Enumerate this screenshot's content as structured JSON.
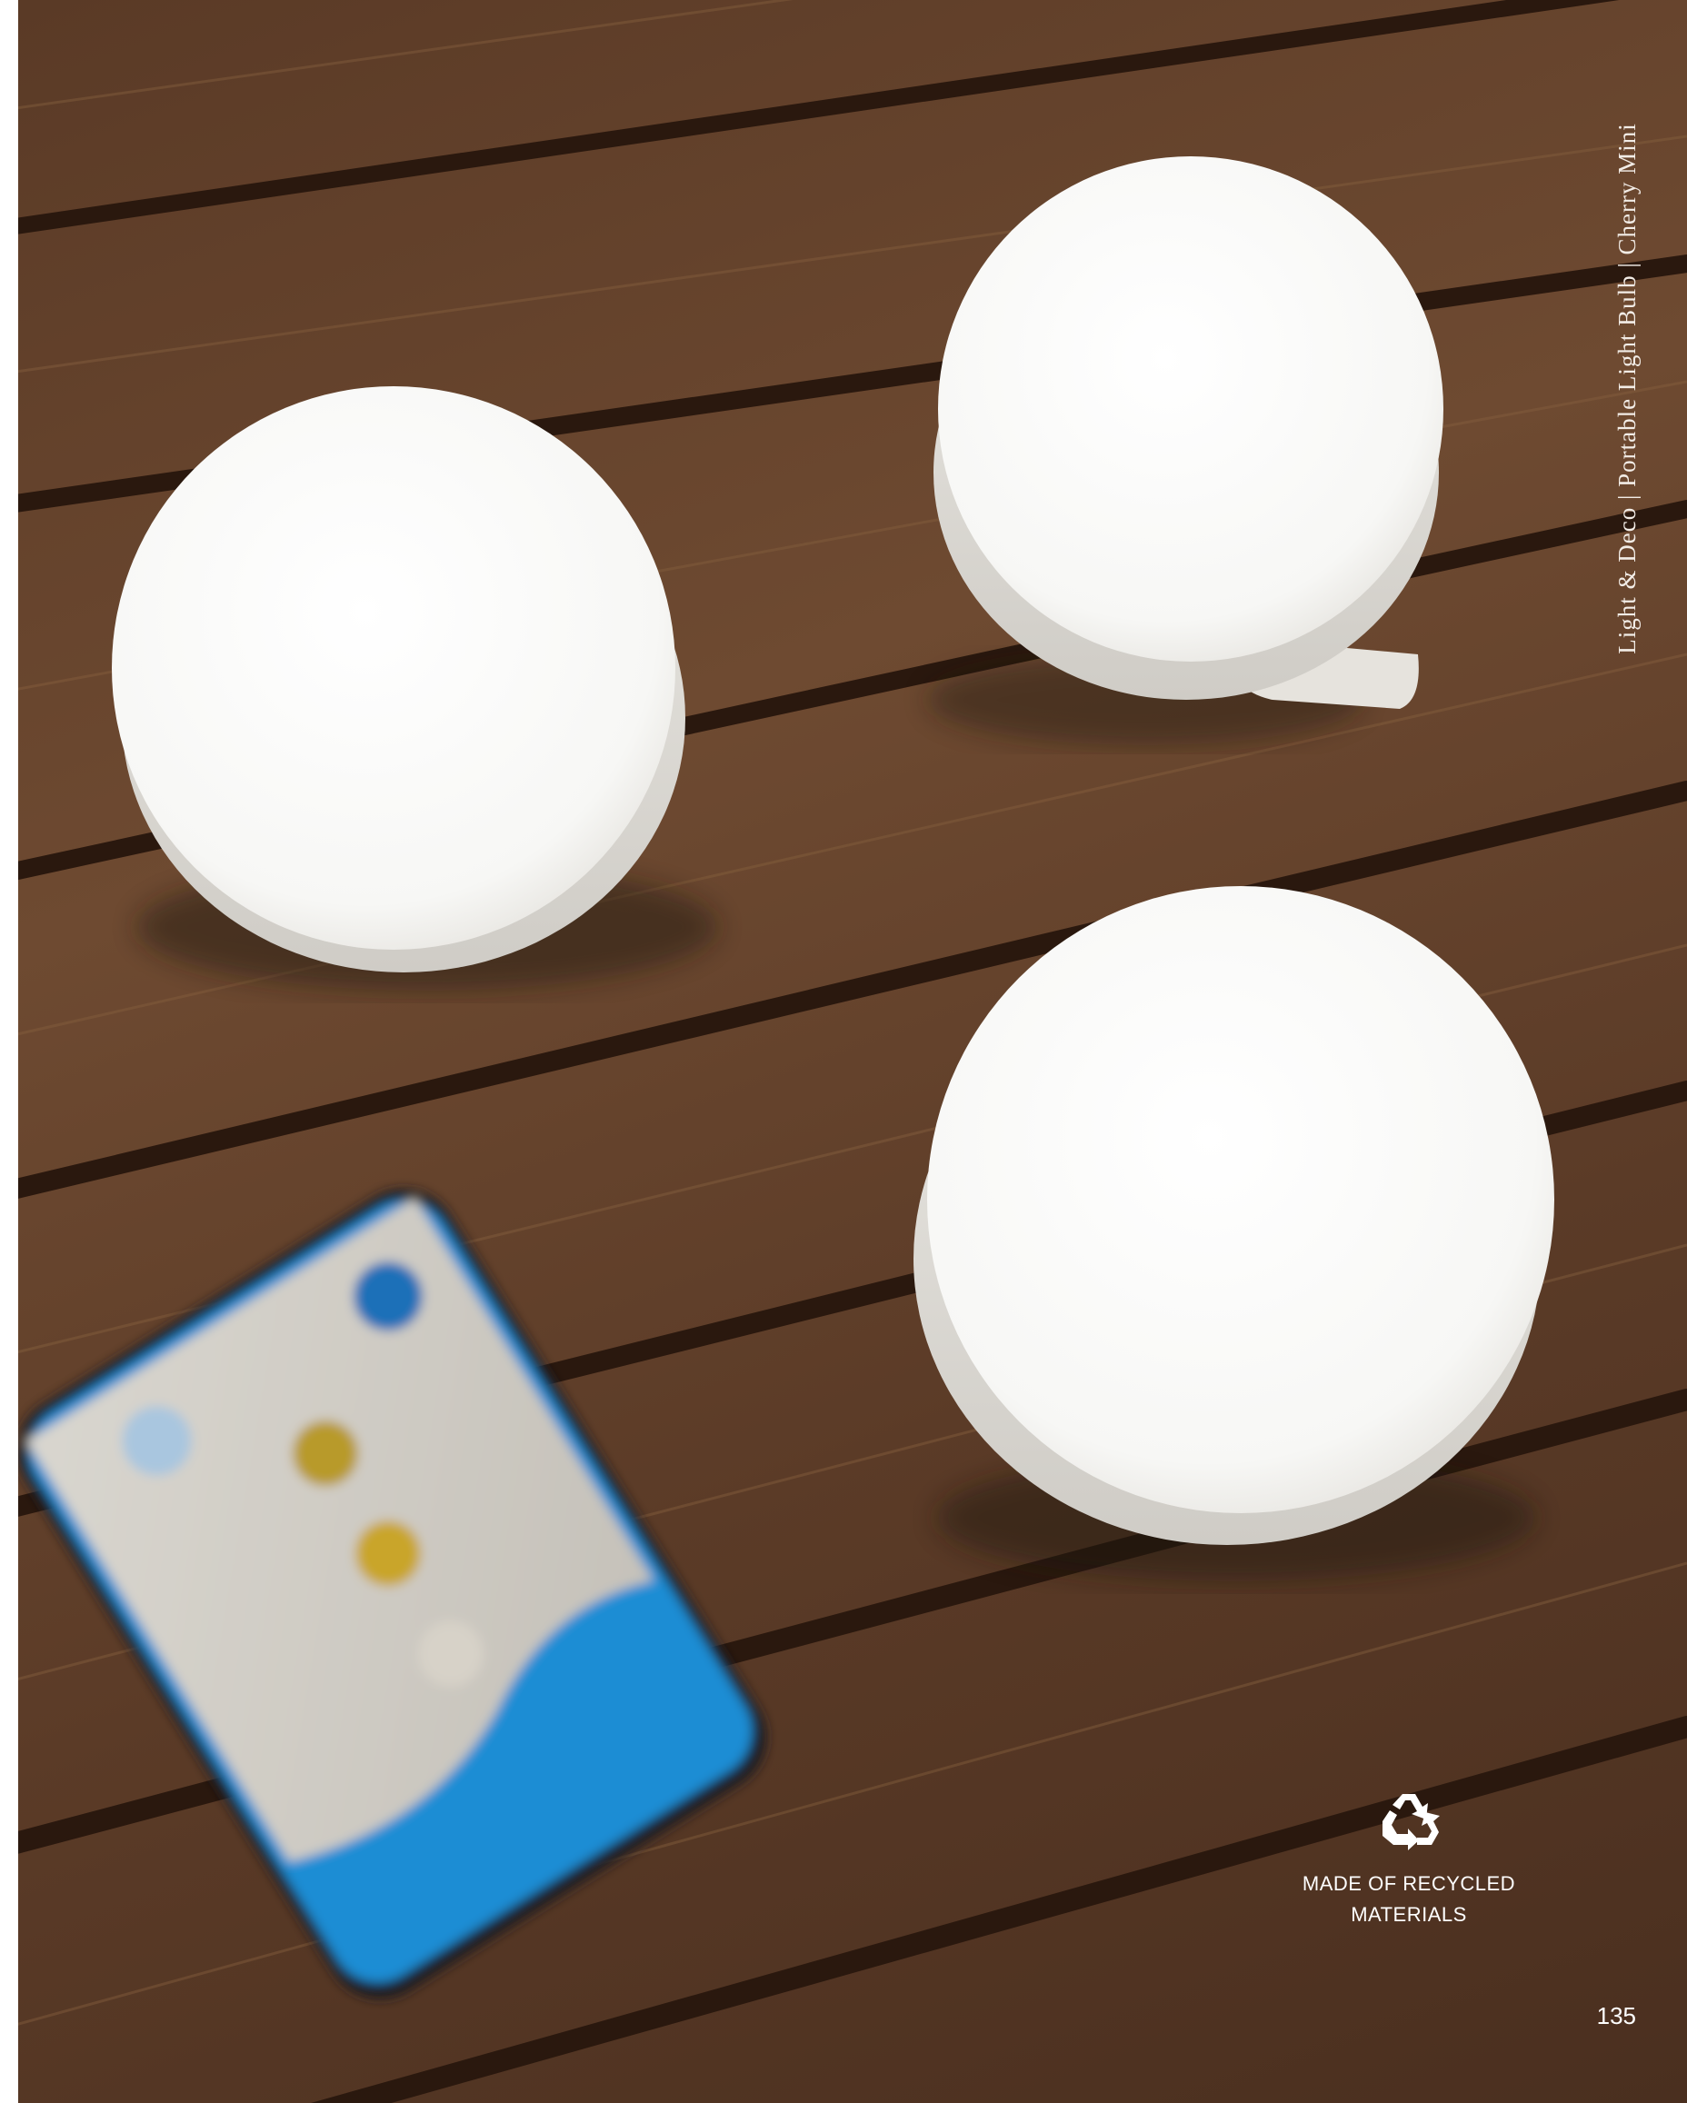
{
  "page": {
    "running_header": "Light & Deco | Portable Light Bulb | Cherry Mini",
    "badge_icon": "recycle-icon",
    "badge_label": "MADE OF RECYCLED\nMATERIALS",
    "page_number": "135"
  },
  "colors": {
    "wood": "#6e4a31",
    "wood_gap": "#2c1a10",
    "lamp": "#fbfbf9",
    "remote_blue": "#1d8fd6",
    "text": "#ffffff"
  }
}
